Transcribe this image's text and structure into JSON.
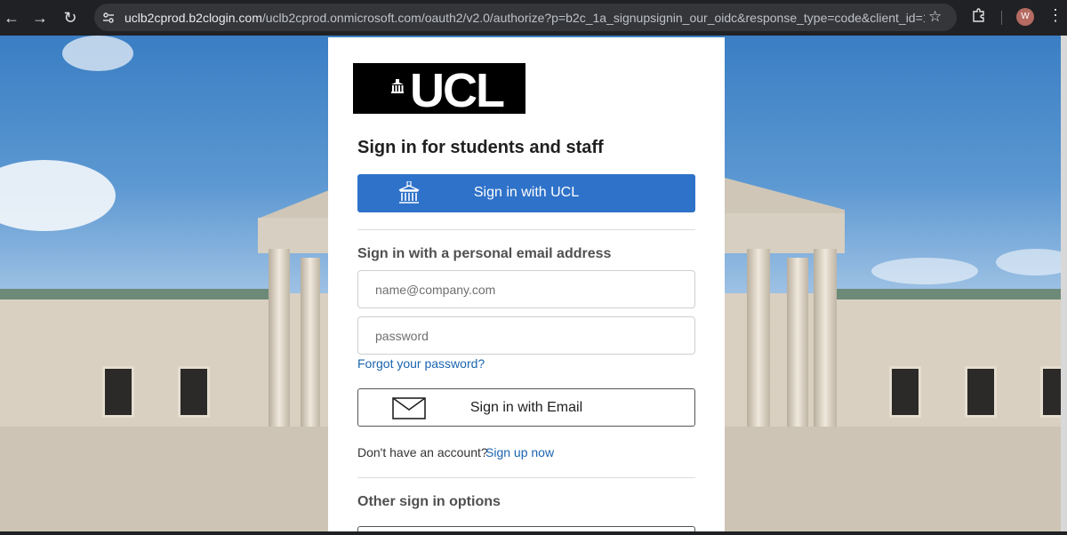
{
  "browser": {
    "url_host": "uclb2cprod.b2clogin.com",
    "url_rest": "/uclb2cprod.onmicrosoft.com/oauth2/v2.0/authorize?p=b2c_1a_signupsignin_our_oidc&response_type=code&client_id=12e...",
    "avatar_letter": "W",
    "icons": {
      "back": "arrow-left-icon",
      "forward": "arrow-right-icon",
      "reload": "reload-icon",
      "site_info": "site-settings-icon",
      "bookmark": "star-icon",
      "extensions": "puzzle-icon",
      "menu": "kebab-menu-icon"
    }
  },
  "panel": {
    "logo_text": "UCL",
    "heading": "Sign in for students and staff",
    "ucl_button_label": "Sign in with UCL",
    "personal_heading": "Sign in with a personal email address",
    "email_placeholder": "name@company.com",
    "password_placeholder": "password",
    "forgot_link": "Forgot your password?",
    "email_button_label": "Sign in with Email",
    "no_account_text": "Don't have an account?",
    "signup_link": "Sign up now",
    "other_options_heading": "Other sign in options"
  },
  "colors": {
    "primary_button": "#2f72c9",
    "link": "#1a64b0"
  }
}
